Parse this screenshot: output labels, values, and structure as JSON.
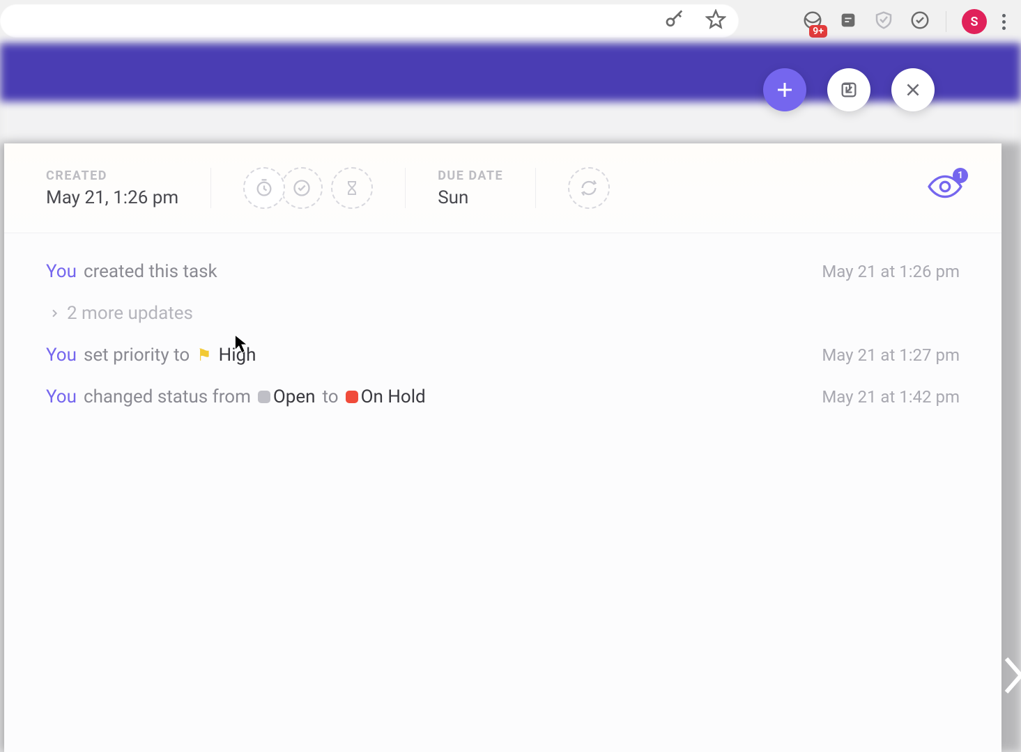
{
  "chrome": {
    "avatar_initial": "S",
    "ext_badge_count": "9+"
  },
  "header": {
    "created_label": "CREATED",
    "created_value": "May 21, 1:26 pm",
    "due_label": "DUE DATE",
    "due_value": "Sun",
    "watchers_count": "1"
  },
  "activity": {
    "row1_user": "You",
    "row1_text": "created this task",
    "row1_time": "May 21 at 1:26 pm",
    "more_updates": "2 more updates",
    "row2_user": "You",
    "row2_text": "set priority to",
    "row2_priority": "High",
    "row2_time": "May 21 at 1:27 pm",
    "row3_user": "You",
    "row3_text1": "changed status from",
    "row3_status_from": "Open",
    "row3_text2": "to",
    "row3_status_to": "On Hold",
    "row3_time": "May 21 at 1:42 pm"
  }
}
